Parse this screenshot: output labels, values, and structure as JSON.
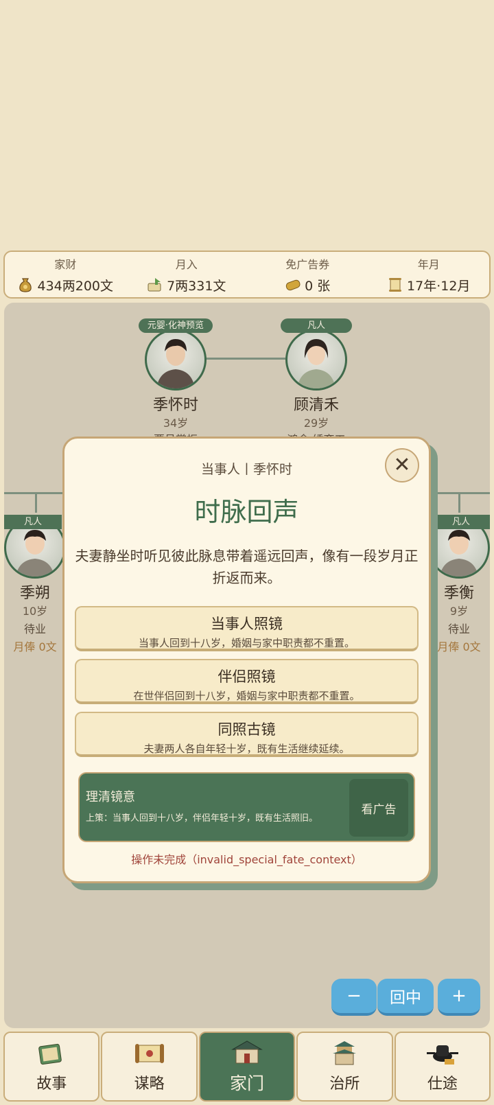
{
  "stats": [
    {
      "label": "家财",
      "value": "434两200文",
      "icon": "money-bag-icon"
    },
    {
      "label": "月入",
      "value": "7两331文",
      "icon": "income-icon"
    },
    {
      "label": "免广告券",
      "value": "0 张",
      "icon": "coupon-icon"
    },
    {
      "label": "年月",
      "value": "17年·12月",
      "icon": "scroll-icon"
    }
  ],
  "family": {
    "husband": {
      "tag": "元婴·化神预览",
      "name": "季怀时",
      "age": "34岁",
      "job": "票号掌柜"
    },
    "wife": {
      "tag": "凡人",
      "name": "顾清禾",
      "age": "29岁",
      "job": "鸿舍·绣育工"
    },
    "child_left": {
      "tag": "凡人",
      "name": "季朔",
      "age": "10岁",
      "job": "待业",
      "salary": "月俸 0文"
    },
    "child_right": {
      "tag": "凡人",
      "name": "季衡",
      "age": "9岁",
      "job": "待业",
      "salary": "月俸 0文"
    }
  },
  "zoom": {
    "minus": "−",
    "center": "回中",
    "plus": "+"
  },
  "modal": {
    "subtitle": "当事人丨季怀时",
    "title": "时脉回声",
    "close": "✕",
    "description": "夫妻静坐时听见彼此脉息带着遥远回声，像有一段岁月正折返而来。",
    "options": [
      {
        "title": "当事人照镜",
        "desc": "当事人回到十八岁，婚姻与家中职责都不重置。"
      },
      {
        "title": "伴侣照镜",
        "desc": "在世伴侣回到十八岁，婚姻与家中职责都不重置。"
      },
      {
        "title": "同照古镜",
        "desc": "夫妻两人各自年轻十岁，既有生活继续延续。"
      }
    ],
    "advice": {
      "title": "理清镜意",
      "body": "上策：当事人回到十八岁，伴侣年轻十岁，既有生活照旧。",
      "button": "看广告"
    },
    "error": "操作未完成（invalid_special_fate_context）"
  },
  "nav": [
    {
      "label": "故事",
      "icon": "story-book-icon"
    },
    {
      "label": "谋略",
      "icon": "strategy-scroll-icon"
    },
    {
      "label": "家门",
      "icon": "family-house-icon",
      "active": true
    },
    {
      "label": "治所",
      "icon": "office-pavilion-icon"
    },
    {
      "label": "仕途",
      "icon": "official-hat-icon"
    }
  ],
  "colors": {
    "accent_green": "#4b7456",
    "background": "#efe4c8",
    "gold_border": "#c9ad7a",
    "zoom_blue": "#5aaedb",
    "error_red": "#a0443a"
  }
}
